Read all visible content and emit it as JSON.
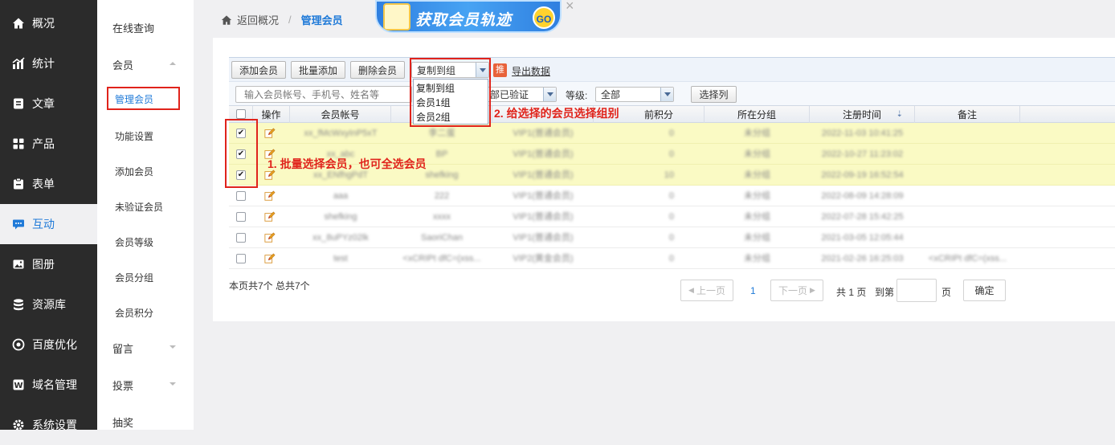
{
  "nav": {
    "items": [
      {
        "label": "概况",
        "icon": "home-icon"
      },
      {
        "label": "统计",
        "icon": "chart-icon"
      },
      {
        "label": "文章",
        "icon": "article-icon"
      },
      {
        "label": "产品",
        "icon": "product-icon"
      },
      {
        "label": "表单",
        "icon": "form-icon"
      },
      {
        "label": "互动",
        "icon": "chat-icon"
      },
      {
        "label": "图册",
        "icon": "album-icon"
      },
      {
        "label": "资源库",
        "icon": "database-icon"
      },
      {
        "label": "百度优化",
        "icon": "seo-icon"
      },
      {
        "label": "域名管理",
        "icon": "domain-icon"
      },
      {
        "label": "系统设置",
        "icon": "gear-icon"
      }
    ],
    "active_index": 5
  },
  "subnav": {
    "items": [
      {
        "label": "在线查询"
      },
      {
        "label": "会员"
      },
      {
        "label": "管理会员"
      },
      {
        "label": "功能设置"
      },
      {
        "label": "添加会员"
      },
      {
        "label": "未验证会员"
      },
      {
        "label": "会员等级"
      },
      {
        "label": "会员分组"
      },
      {
        "label": "会员积分"
      },
      {
        "label": "留言"
      },
      {
        "label": "投票"
      },
      {
        "label": "抽奖"
      }
    ]
  },
  "breadcrumb": {
    "back": "返回概况",
    "separator": "/",
    "current": "管理会员"
  },
  "banner": {
    "text": "获取会员轨迹",
    "go": "GO",
    "close": "×"
  },
  "toolbar": {
    "add": "添加会员",
    "batch_add": "批量添加",
    "delete": "删除会员",
    "copy_group": "复制到组",
    "push_badge": "推",
    "export": "导出数据"
  },
  "dropdown": {
    "options": [
      "复制到组",
      "会员1组",
      "会员2组"
    ]
  },
  "filter": {
    "search_placeholder": "输入会员帐号、手机号、姓名等",
    "verify": "部已验证",
    "level_label": "等级:",
    "level_value": "全部",
    "choose_cols": "选择列"
  },
  "table": {
    "headers": {
      "op": "操作",
      "account": "会员帐号",
      "points": "前积分",
      "group": "所在分组",
      "reg_time": "注册时间",
      "remark": "备注"
    },
    "rows": [
      {
        "checked": true,
        "account": "xx_fMcWxyInP5xT",
        "name": "李二蛋",
        "level": "VIP1(普通会员)",
        "points": "0",
        "group": "未分组",
        "time": "2022-11-03 10:41:25",
        "remark": ""
      },
      {
        "checked": true,
        "account": "xx_abc",
        "name": "BP",
        "level": "VIP1(普通会员)",
        "points": "0",
        "group": "未分组",
        "time": "2022-10-27 11:23:02",
        "remark": ""
      },
      {
        "checked": true,
        "account": "xx_ENfhgPdT",
        "name": "shefking",
        "level": "VIP1(普通会员)",
        "points": "10",
        "group": "未分组",
        "time": "2022-09-19 16:52:54",
        "remark": ""
      },
      {
        "checked": false,
        "account": "aaa",
        "name": "222",
        "level": "VIP1(普通会员)",
        "points": "0",
        "group": "未分组",
        "time": "2022-08-09 14:28:09",
        "remark": ""
      },
      {
        "checked": false,
        "account": "shefking",
        "name": "xxxx",
        "level": "VIP1(普通会员)",
        "points": "0",
        "group": "未分组",
        "time": "2022-07-28 15:42:25",
        "remark": ""
      },
      {
        "checked": false,
        "account": "xx_8uPYz02lk",
        "name": "SaoriChan",
        "level": "VIP1(普通会员)",
        "points": "0",
        "group": "未分组",
        "time": "2021-03-05 12:05:44",
        "remark": ""
      },
      {
        "checked": false,
        "account": "test",
        "name": "<xCRIPt dfC=(xss...",
        "level": "VIP2(黄金会员)",
        "points": "0",
        "group": "未分组",
        "time": "2021-02-26 16:25:03",
        "remark": "<xCRIPt dfC=(xss..."
      }
    ]
  },
  "annotations": {
    "step1": "1. 批量选择会员，也可全选会员",
    "step2": "2. 给选择的会员选择组别"
  },
  "footer": {
    "summary": "本页共7个 总共7个",
    "prev": "上一页",
    "page": "1",
    "next": "下一页",
    "total": "共 1 页",
    "goto": "到第",
    "page_unit": "页",
    "confirm": "确定"
  },
  "colors": {
    "accent": "#1f7ad8",
    "highlight": "#e0231b",
    "selected_row": "#fafac4",
    "nav_bg": "#2b2b2b"
  }
}
